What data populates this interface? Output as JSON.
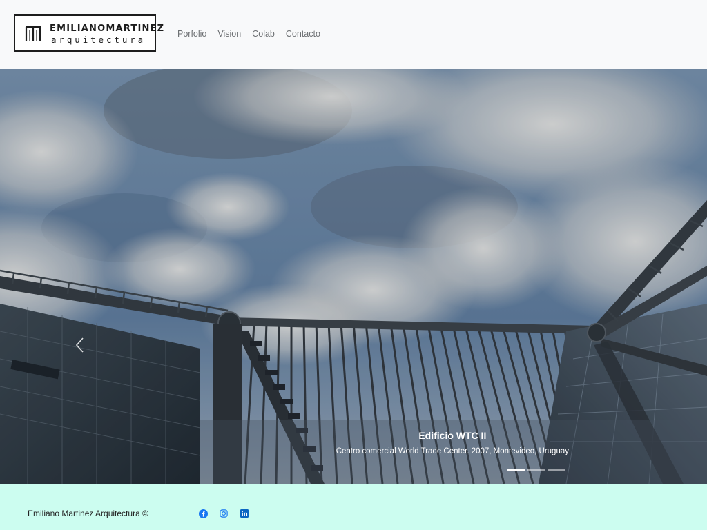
{
  "brand": {
    "name": "EMILIANOMARTINEZ",
    "subtitle": "arquitectura"
  },
  "nav": {
    "items": [
      {
        "label": "Porfolio"
      },
      {
        "label": "Vision"
      },
      {
        "label": "Colab"
      },
      {
        "label": "Contacto"
      }
    ]
  },
  "carousel": {
    "prev_icon": "chevron-left-icon",
    "slide": {
      "title": "Edificio WTC II",
      "text": "Centro comercial World Trade Center. 2007, Montevideo, Uruguay"
    },
    "indicator_count": 3,
    "active_indicator": 0
  },
  "footer": {
    "copyright": "Emiliano Martinez Arquitectura ©",
    "social": [
      {
        "icon": "facebook-icon",
        "color": "#1877f2"
      },
      {
        "icon": "instagram-icon",
        "color": "#1877f2"
      },
      {
        "icon": "linkedin-icon",
        "color": "#0a66c2"
      }
    ]
  },
  "colors": {
    "footer_bg": "#ccfdf0",
    "nav_text": "#6c6f72",
    "accent": "#1877f2"
  }
}
